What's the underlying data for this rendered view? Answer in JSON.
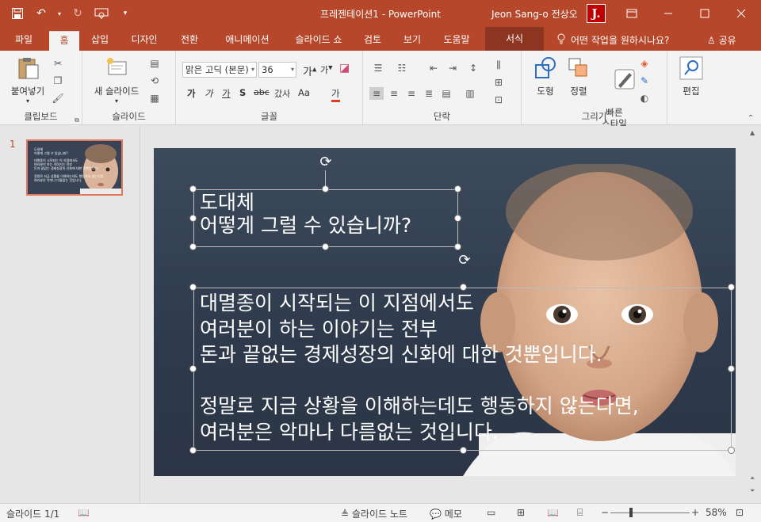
{
  "app": {
    "document_title": "프레젠테이션1  -  PowerPoint",
    "user_name": "Jeon Sang-o 전상오",
    "avatar_letter": "J."
  },
  "tabs": [
    {
      "label": "파일"
    },
    {
      "label": "홈"
    },
    {
      "label": "삽입"
    },
    {
      "label": "디자인"
    },
    {
      "label": "전환"
    },
    {
      "label": "애니메이션"
    },
    {
      "label": "슬라이드 쇼"
    },
    {
      "label": "검토"
    },
    {
      "label": "보기"
    },
    {
      "label": "도움말"
    },
    {
      "label": "서식"
    }
  ],
  "active_tab": "홈",
  "tell_me": "어떤 작업을 원하시나요?",
  "share": "공유",
  "ribbon": {
    "clipboard": {
      "paste": "붙여넣기",
      "label": "클립보드"
    },
    "slides": {
      "new_slide": "새 슬라이드",
      "label": "슬라이드"
    },
    "font": {
      "font_name": "맑은 고딕 (본문)",
      "font_size": "36",
      "bold": "가",
      "italic": "가",
      "underline": "가",
      "shadow": "S",
      "strike": "abc",
      "spacing": "갔사",
      "case": "Aa",
      "clear": "가",
      "label": "글꼴"
    },
    "paragraph": {
      "label": "단락"
    },
    "drawing": {
      "shapes": "도형",
      "arrange": "정렬",
      "quick_styles": "빠른\n스타일",
      "label": "그리기"
    },
    "editing": {
      "label": "편집"
    }
  },
  "thumbnail": {
    "number": "1"
  },
  "slide": {
    "title": "도대체\n어떻게 그럴 수 있습니까?",
    "body": "대멸종이 시작되는 이 지점에서도\n여러분이 하는 이야기는 전부\n돈과 끝없는 경제성장의 신화에 대한 것뿐입니다.\n\n정말로 지금 상황을 이해하는데도 행동하지 않는다면,\n여러분은 악마나 다름없는 것입니다."
  },
  "status": {
    "slide_info": "슬라이드 1/1",
    "notes": "슬라이드 노트",
    "comments": "메모",
    "zoom": "58%"
  },
  "colors": {
    "accent": "#b7472a",
    "selection": "#e2775b"
  }
}
